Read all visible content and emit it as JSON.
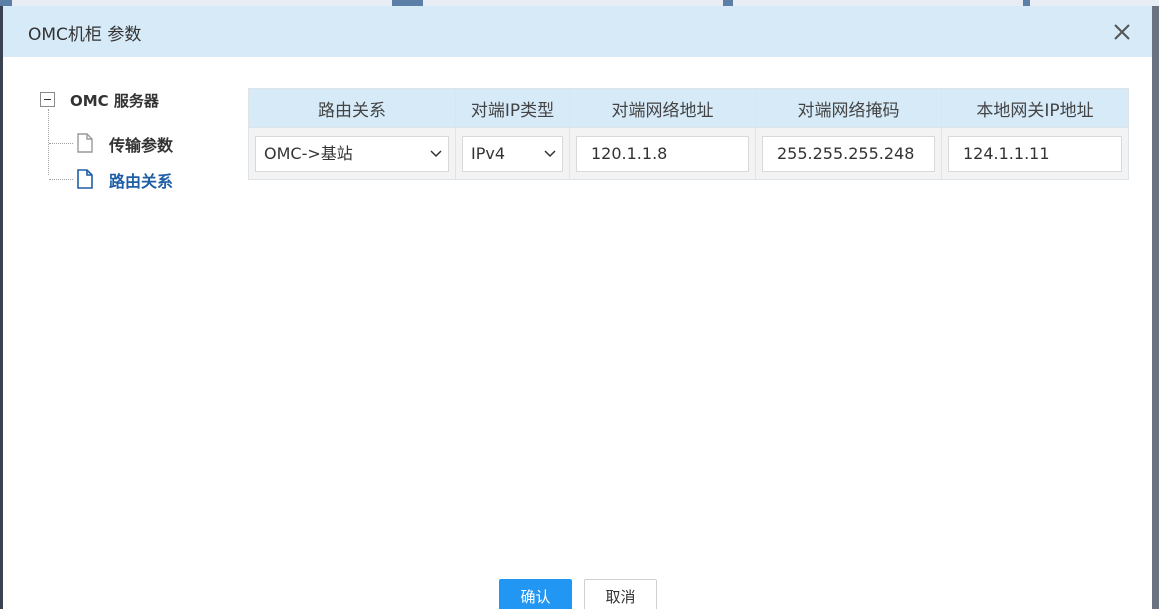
{
  "dialog": {
    "title": "OMC机柜 参数",
    "close_icon": "close-icon"
  },
  "tree": {
    "root": {
      "label": "OMC 服务器",
      "expanded": true
    },
    "items": [
      {
        "label": "传输参数",
        "icon": "file-icon",
        "selected": false
      },
      {
        "label": "路由关系",
        "icon": "file-icon",
        "selected": true
      }
    ]
  },
  "table": {
    "columns": [
      "路由关系",
      "对端IP类型",
      "对端网络地址",
      "对端网络掩码",
      "本地网关IP地址"
    ],
    "rows": [
      {
        "route_relation": "OMC->基站",
        "ip_type": "IPv4",
        "peer_network_address": "120.1.1.8",
        "peer_network_mask": "255.255.255.248",
        "local_gateway_ip": "124.1.1.11"
      }
    ]
  },
  "footer": {
    "confirm_label": "确认",
    "cancel_label": "取消"
  },
  "colors": {
    "header_bg": "#d6eaf8",
    "primary": "#2196f3",
    "selected_text": "#1f5fa6"
  }
}
